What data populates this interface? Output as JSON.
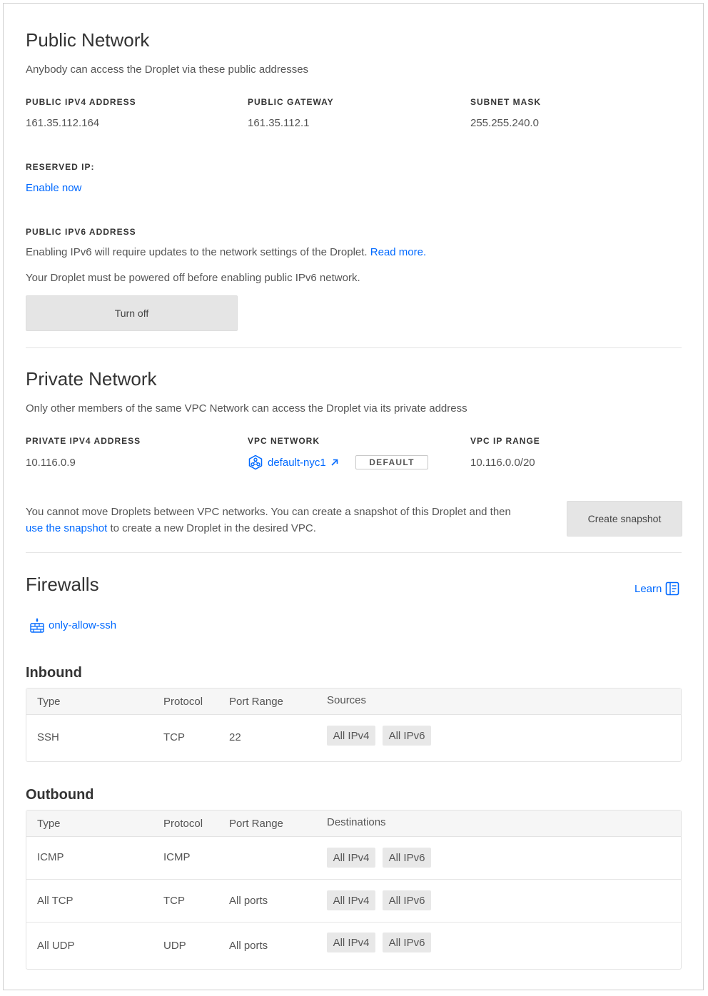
{
  "public": {
    "title": "Public Network",
    "description": "Anybody can access the Droplet via these public addresses",
    "ipv4_label": "PUBLIC IPV4 ADDRESS",
    "ipv4_value": "161.35.112.164",
    "gateway_label": "PUBLIC GATEWAY",
    "gateway_value": "161.35.112.1",
    "subnet_label": "SUBNET MASK",
    "subnet_value": "255.255.240.0",
    "reserved_label": "RESERVED IP:",
    "reserved_link": "Enable now",
    "ipv6_label": "PUBLIC IPV6 ADDRESS",
    "ipv6_note": "Enabling IPv6 will require updates to the network settings of the Droplet.",
    "ipv6_read_more": "Read more.",
    "ipv6_power_note": "Your Droplet must be powered off before enabling public IPv6 network.",
    "turn_off_button": "Turn off"
  },
  "private": {
    "title": "Private Network",
    "description": "Only other members of the same VPC Network can access the Droplet via its private address",
    "ipv4_label": "PRIVATE IPV4 ADDRESS",
    "ipv4_value": "10.116.0.9",
    "vpc_label": "VPC NETWORK",
    "vpc_name": "default-nyc1",
    "vpc_badge": "DEFAULT",
    "range_label": "VPC IP RANGE",
    "range_value": "10.116.0.0/20",
    "move_note_1": "You cannot move Droplets between VPC networks. You can create a snapshot of this Droplet and then",
    "move_note_link": "use the snapshot",
    "move_note_2": "to create a new Droplet in the desired VPC.",
    "snapshot_button": "Create snapshot"
  },
  "firewalls": {
    "title": "Firewalls",
    "learn_link": "Learn",
    "firewall_name": "only-allow-ssh",
    "inbound": {
      "title": "Inbound",
      "headers": [
        "Type",
        "Protocol",
        "Port Range",
        "Sources"
      ],
      "rows": [
        {
          "type": "SSH",
          "protocol": "TCP",
          "port": "22",
          "chips": [
            "All IPv4",
            "All IPv6"
          ]
        }
      ]
    },
    "outbound": {
      "title": "Outbound",
      "headers": [
        "Type",
        "Protocol",
        "Port Range",
        "Destinations"
      ],
      "rows": [
        {
          "type": "ICMP",
          "protocol": "ICMP",
          "port": "",
          "chips": [
            "All IPv4",
            "All IPv6"
          ]
        },
        {
          "type": "All TCP",
          "protocol": "TCP",
          "port": "All ports",
          "chips": [
            "All IPv4",
            "All IPv6"
          ]
        },
        {
          "type": "All UDP",
          "protocol": "UDP",
          "port": "All ports",
          "chips": [
            "All IPv4",
            "All IPv6"
          ]
        }
      ]
    }
  },
  "colors": {
    "link": "#0069ff",
    "button_bg": "#e5e5e5",
    "chip_bg": "#e8e8e8",
    "table_header_bg": "#f6f6f6"
  },
  "icons": {
    "vpc": "vpc-network-icon",
    "external": "external-link-arrow-icon",
    "learn": "document-icon",
    "firewall": "firewall-icon"
  }
}
